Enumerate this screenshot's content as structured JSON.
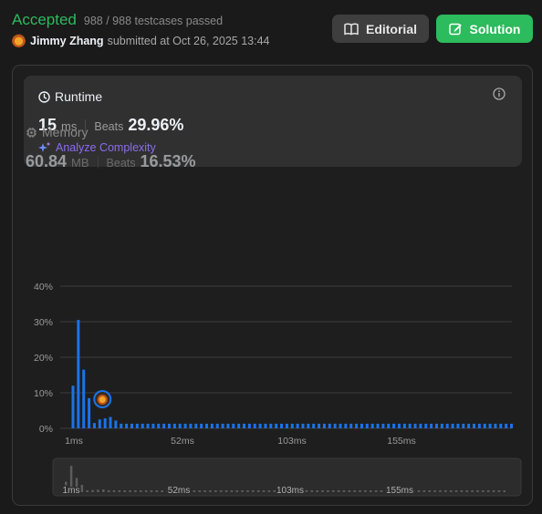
{
  "header": {
    "status": "Accepted",
    "tests_passed": "988 / 988 testcases passed",
    "user": "Jimmy Zhang",
    "submitted": "submitted at Oct 26, 2025 13:44",
    "editorial_label": "Editorial",
    "solution_label": "Solution"
  },
  "runtime": {
    "title": "Runtime",
    "value": "15",
    "unit": "ms",
    "beats_label": "Beats",
    "beats_value": "29.96%",
    "analyze_label": "Analyze Complexity"
  },
  "memory": {
    "title": "Memory",
    "value": "60.84",
    "unit": "MB",
    "beats_label": "Beats",
    "beats_value": "16.53%"
  },
  "colors": {
    "accent_green": "#2cbb5d",
    "bar_blue": "#1a73e8",
    "analyze_purple": "#8c6cf0"
  },
  "chart_data": {
    "type": "bar",
    "ytick_labels": [
      "40%",
      "30%",
      "20%",
      "10%",
      "0%"
    ],
    "xtick_labels": [
      "1ms",
      "52ms",
      "103ms",
      "155ms"
    ],
    "ylim": [
      0,
      40
    ],
    "user_marker_bar_index": 6,
    "values": [
      12,
      30.5,
      16.5,
      8.5,
      1.5,
      2.5,
      2.8,
      3.2,
      2.2,
      1.3,
      1.3,
      1.3,
      1.3,
      1.3,
      1.3,
      1.3,
      1.3,
      1.3,
      1.3,
      1.3,
      1.3,
      1.3,
      1.3,
      1.3,
      1.3,
      1.3,
      1.3,
      1.3,
      1.3,
      1.3,
      1.3,
      1.3,
      1.3,
      1.3,
      1.3,
      1.3,
      1.3,
      1.3,
      1.3,
      1.3,
      1.3,
      1.3,
      1.3,
      1.3,
      1.3,
      1.3,
      1.3,
      1.3,
      1.3,
      1.3,
      1.3,
      1.3,
      1.3,
      1.3,
      1.3,
      1.3,
      1.3,
      1.3,
      1.3,
      1.3,
      1.3,
      1.3,
      1.3,
      1.3,
      1.3,
      1.3,
      1.3,
      1.3,
      1.3,
      1.3,
      1.3,
      1.3,
      1.3,
      1.3,
      1.3,
      1.3,
      1.3,
      1.3,
      1.3,
      1.3,
      1.3,
      1.3,
      1.3
    ],
    "grid": true,
    "navigator_xtick_labels": [
      "1ms",
      "52ms",
      "103ms",
      "155ms"
    ]
  }
}
